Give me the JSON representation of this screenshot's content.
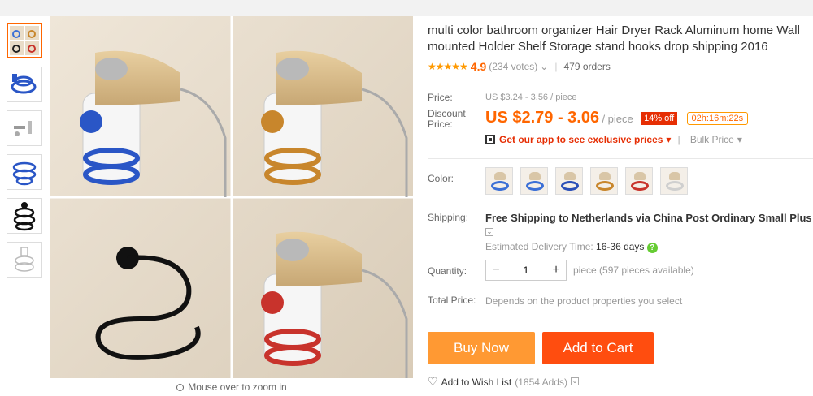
{
  "thumbnails": [
    {
      "name": "thumb-collage"
    },
    {
      "name": "thumb-blue-rack"
    },
    {
      "name": "thumb-hardware"
    },
    {
      "name": "thumb-blue-spiral"
    },
    {
      "name": "thumb-black-spiral"
    },
    {
      "name": "thumb-sketch"
    }
  ],
  "zoom_hint": "Mouse over to zoom in",
  "product": {
    "title": "multi color bathroom organizer Hair Dryer Rack Aluminum home Wall mounted Holder Shelf Storage stand hooks drop shipping 2016",
    "stars": "★★★★★",
    "rating": "4.9",
    "votes": "(234 votes)",
    "orders": "479 orders"
  },
  "price": {
    "label": "Price:",
    "original": "US $3.24 - 3.56 / piece",
    "discount_label": "Discount Price:",
    "discount": "US $2.79 - 3.06",
    "unit": "/ piece",
    "off_badge": "14% off",
    "timer": "02h:16m:22s"
  },
  "app_promo": {
    "text": "Get our app to see exclusive prices",
    "bulk": "Bulk Price"
  },
  "color": {
    "label": "Color:",
    "swatches": [
      {
        "ring": "#3b6fd6"
      },
      {
        "ring": "#3b6fd6"
      },
      {
        "ring": "#2a4fb8"
      },
      {
        "ring": "#c8862c"
      },
      {
        "ring": "#c8332c"
      },
      {
        "ring": "#cfcfcf"
      }
    ]
  },
  "shipping": {
    "label": "Shipping:",
    "text": "Free Shipping to Netherlands via China Post Ordinary Small Plus",
    "est_label": "Estimated Delivery Time:",
    "est_value": "16-36 days"
  },
  "quantity": {
    "label": "Quantity:",
    "minus": "−",
    "value": "1",
    "plus": "+",
    "available": "piece (597 pieces available)"
  },
  "total": {
    "label": "Total Price:",
    "text": "Depends on the product properties you select"
  },
  "buttons": {
    "buy": "Buy Now",
    "cart": "Add to Cart"
  },
  "wishlist": {
    "text": "Add to Wish List",
    "count": "(1854 Adds)"
  },
  "colors": {
    "accent": "#ff6600",
    "buy_button": "#ff9933",
    "cart_button": "#ff4d0f",
    "badge_red": "#e62e04"
  }
}
